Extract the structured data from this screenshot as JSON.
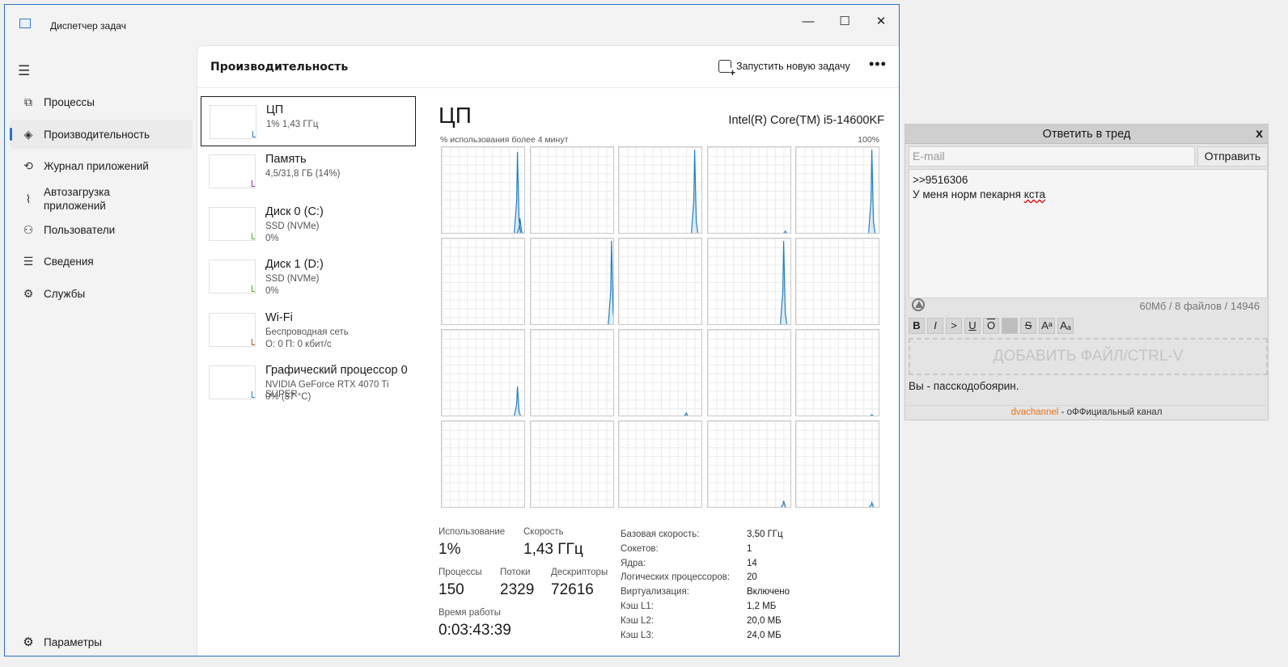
{
  "window": {
    "title": "Диспетчер задач",
    "controls": {
      "minimize": "—",
      "maximize": "☐",
      "close": "✕"
    }
  },
  "nav": {
    "items": [
      {
        "label": "Процессы",
        "icon": "processes-icon",
        "glyph": "⧉"
      },
      {
        "label": "Производительность",
        "icon": "performance-icon",
        "glyph": "◈"
      },
      {
        "label": "Журнал приложений",
        "icon": "history-icon",
        "glyph": "⟲"
      },
      {
        "label": "Автозагрузка приложений",
        "icon": "startup-icon",
        "glyph": "⌇"
      },
      {
        "label": "Пользователи",
        "icon": "users-icon",
        "glyph": "⚇"
      },
      {
        "label": "Сведения",
        "icon": "details-icon",
        "glyph": "☰"
      },
      {
        "label": "Службы",
        "icon": "services-icon",
        "glyph": "⚙"
      }
    ],
    "settings": "Параметры"
  },
  "header": {
    "title": "Производительность",
    "run_task": "Запустить новую задачу",
    "more": "•••"
  },
  "devices": [
    {
      "name": "ЦП",
      "sub1": "1% 1,43 ГГц",
      "sub2": "",
      "color": "#1f7fc4"
    },
    {
      "name": "Память",
      "sub1": "4,5/31,8 ГБ (14%)",
      "sub2": "",
      "color": "#9b2fae"
    },
    {
      "name": "Диск 0 (C:)",
      "sub1": "SSD (NVMe)",
      "sub2": "0%",
      "color": "#4caf22"
    },
    {
      "name": "Диск 1 (D:)",
      "sub1": "SSD (NVMe)",
      "sub2": "0%",
      "color": "#4caf22"
    },
    {
      "name": "Wi-Fi",
      "sub1": "Беспроводная сеть",
      "sub2": "О: 0 П: 0 кбит/с",
      "color": "#b05d1c"
    },
    {
      "name": "Графический процессор 0",
      "sub1": "NVIDIA GeForce RTX 4070 Ti SUPER",
      "sub2": "0% (37 °C)",
      "color": "#1f7fc4"
    }
  ],
  "cpu": {
    "title": "ЦП",
    "model": "Intel(R) Core(TM) i5-14600KF",
    "usage_label": "% использования более 4 минут",
    "usage_max": "100%",
    "line_color": "#1f7fc4",
    "core_peaks": [
      [
        [
          0.9,
          0.95
        ],
        [
          0.93,
          0.18
        ]
      ],
      [],
      [
        [
          0.9,
          0.98
        ]
      ],
      [
        [
          0.92,
          0.03
        ]
      ],
      [
        [
          0.9,
          0.98
        ]
      ],
      [],
      [
        [
          0.96,
          0.98
        ]
      ],
      [],
      [
        [
          0.9,
          0.98
        ]
      ],
      [],
      [
        [
          0.9,
          0.35
        ]
      ],
      [],
      [
        [
          0.8,
          0.04
        ]
      ],
      [],
      [
        [
          0.9,
          0.02
        ]
      ],
      [],
      [],
      [],
      [
        [
          0.9,
          0.08
        ]
      ],
      [
        [
          0.9,
          0.06
        ]
      ]
    ],
    "stats": {
      "usage_label": "Использование",
      "usage_value": "1%",
      "speed_label": "Скорость",
      "speed_value": "1,43 ГГц",
      "processes_label": "Процессы",
      "processes_value": "150",
      "threads_label": "Потоки",
      "threads_value": "2329",
      "handles_label": "Дескрипторы",
      "handles_value": "72616",
      "uptime_label": "Время работы",
      "uptime_value": "0:03:43:39"
    },
    "specs": [
      {
        "k": "Базовая скорость:",
        "v": "3,50 ГГц"
      },
      {
        "k": "Сокетов:",
        "v": "1"
      },
      {
        "k": "Ядра:",
        "v": "14"
      },
      {
        "k": "Логических процессоров:",
        "v": "20"
      },
      {
        "k": "Виртуализация:",
        "v": "Включено"
      },
      {
        "k": "Кэш L1:",
        "v": "1,2 МБ"
      },
      {
        "k": "Кэш L2:",
        "v": "20,0 МБ"
      },
      {
        "k": "Кэш L3:",
        "v": "24,0 МБ"
      }
    ]
  },
  "reply": {
    "title": "Ответить в тред",
    "close": "x",
    "email_placeholder": "E-mail",
    "send": "Отправить",
    "message_line1": ">>9516306",
    "message_line2_start": "У меня норм пекарня ",
    "message_line2_wavy": "кста",
    "files_info": "60Мб / 8 файлов / 14946",
    "toolbar": [
      "B",
      "I",
      ">",
      "U",
      "O",
      " ",
      "S",
      "Aᵃ",
      "Aₐ"
    ],
    "dropzone": "ДОБАВИТЬ ФАЙЛ/CTRL-V",
    "captcha": "Вы - пасскодобоярин.",
    "channel_link": "dvachannel",
    "channel_text": " - оФФициальный канал"
  }
}
